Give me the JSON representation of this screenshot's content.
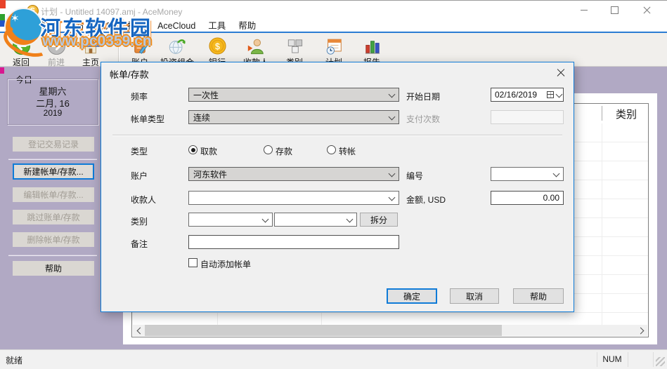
{
  "window": {
    "title": "计划 - Untitled 14097.amj - AceMoney",
    "controls": [
      "minimize-icon",
      "maximize-icon",
      "close-icon"
    ]
  },
  "menu": {
    "items": [
      "文件",
      "编辑",
      "查看",
      "账户",
      "报告",
      "AceCloud",
      "工具",
      "帮助"
    ]
  },
  "toolbar": {
    "items": [
      {
        "icon": "back-icon",
        "label": "返回",
        "enabled": true
      },
      {
        "icon": "forward-icon",
        "label": "前进",
        "enabled": false
      },
      {
        "icon": "home-icon",
        "label": "主页",
        "enabled": true
      },
      {
        "icon": "accounts-icon",
        "label": "账户",
        "enabled": true
      },
      {
        "icon": "portfolio-icon",
        "label": "投资组合",
        "enabled": true
      },
      {
        "icon": "bank-icon",
        "label": "银行",
        "enabled": true
      },
      {
        "icon": "payees-icon",
        "label": "收款人",
        "enabled": true
      },
      {
        "icon": "categories-icon",
        "label": "类别",
        "enabled": true
      },
      {
        "icon": "schedule-icon",
        "label": "计划",
        "enabled": true
      },
      {
        "icon": "reports-icon",
        "label": "报告",
        "enabled": true
      }
    ]
  },
  "watermark": {
    "site_name": "河东软件园",
    "site_url": "www.pc0359.cn"
  },
  "sidebar": {
    "today": {
      "title": "今日",
      "weekday": "星期六",
      "date": "二月, 16",
      "year": "2019"
    },
    "buttons": [
      {
        "label": "登记交易记录",
        "enabled": false
      },
      {
        "label": "新建帐单/存款...",
        "enabled": true,
        "focused": true
      },
      {
        "label": "编辑帐单/存款...",
        "enabled": false
      },
      {
        "label": "跳过账单/存款",
        "enabled": false
      },
      {
        "label": "删除帐单/存款",
        "enabled": false
      },
      {
        "label": "帮助",
        "enabled": true
      }
    ]
  },
  "plan_table": {
    "category_header": "类别"
  },
  "dialog": {
    "title": "帐单/存款",
    "frequency": {
      "label": "频率",
      "value": "一次性"
    },
    "start_date": {
      "label": "开始日期",
      "value": "02/16/2019"
    },
    "bill_type": {
      "label": "帐单类型",
      "value": "连续"
    },
    "payment_count": {
      "label": "支付次数",
      "value": ""
    },
    "type": {
      "label": "类型",
      "options": [
        {
          "label": "取款",
          "selected": true
        },
        {
          "label": "存款",
          "selected": false
        },
        {
          "label": "转帐",
          "selected": false
        }
      ]
    },
    "account": {
      "label": "账户",
      "value": "河东软件"
    },
    "number": {
      "label": "编号",
      "value": ""
    },
    "payee": {
      "label": "收款人",
      "value": ""
    },
    "amount": {
      "label": "金额, USD",
      "value": "0.00"
    },
    "category": {
      "label": "类别",
      "value1": "",
      "value2": "",
      "split_button": "拆分"
    },
    "memo": {
      "label": "备注",
      "value": ""
    },
    "auto_add": {
      "label": "自动添加帐单",
      "checked": false
    },
    "buttons": {
      "ok": "确定",
      "cancel": "取消",
      "help": "帮助"
    }
  },
  "statusbar": {
    "ready": "就绪",
    "num": "NUM"
  },
  "colors": {
    "accent": "#0f7bd7",
    "desktop": "#b1a9c4",
    "menu_keyline": "#2b7cd3"
  }
}
